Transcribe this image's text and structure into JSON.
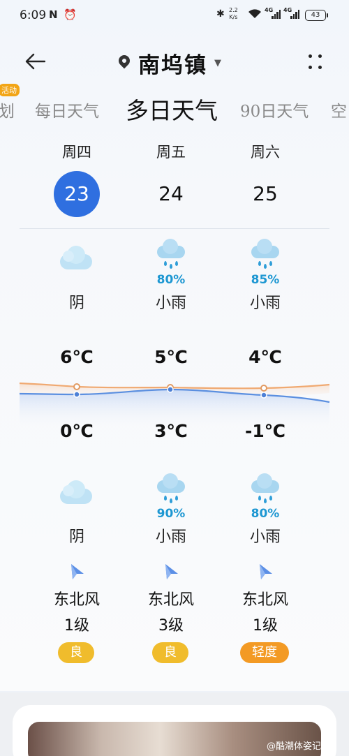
{
  "status_bar": {
    "time": "6:09",
    "speed_value": "2.2",
    "speed_unit": "K/s",
    "signal1_tag": "4G",
    "signal2_tag": "4G",
    "battery": "43"
  },
  "header": {
    "location": "南坞镇",
    "back_icon": "arrow-left-icon",
    "more_icon": "four-dots-icon"
  },
  "tabs": {
    "badge": "活动",
    "items": [
      "划",
      "每日天气",
      "多日天气",
      "90日天气",
      "空"
    ],
    "active_index": 2
  },
  "days": [
    {
      "weekday": "周四",
      "date": "23",
      "selected": true,
      "day_icon": "cloudy-icon",
      "day_precip": "",
      "day_cond": "阴",
      "high": "6℃",
      "low": "0℃",
      "night_icon": "cloudy-icon",
      "night_precip": "",
      "night_cond": "阴",
      "wind_dir": "东北风",
      "wind_level": "1级",
      "aqi": "良",
      "aqi_color": "#f0bc2c"
    },
    {
      "weekday": "周五",
      "date": "24",
      "selected": false,
      "day_icon": "light-rain-icon",
      "day_precip": "80%",
      "day_cond": "小雨",
      "high": "5℃",
      "low": "3℃",
      "night_icon": "light-rain-icon",
      "night_precip": "90%",
      "night_cond": "小雨",
      "wind_dir": "东北风",
      "wind_level": "3级",
      "aqi": "良",
      "aqi_color": "#f0bc2c"
    },
    {
      "weekday": "周六",
      "date": "25",
      "selected": false,
      "day_icon": "light-rain-icon",
      "day_precip": "85%",
      "day_cond": "小雨",
      "high": "4℃",
      "low": "-1℃",
      "night_icon": "light-rain-icon",
      "night_precip": "80%",
      "night_cond": "小雨",
      "wind_dir": "东北风",
      "wind_level": "1级",
      "aqi": "轻度",
      "aqi_color": "#f39a24"
    }
  ],
  "colors": {
    "accent": "#2f6fe0",
    "high_line": "#f0a971",
    "low_line": "#5b8fe0",
    "precip_text": "#1d97d2"
  },
  "watermark": "@酷潮体姿记"
}
